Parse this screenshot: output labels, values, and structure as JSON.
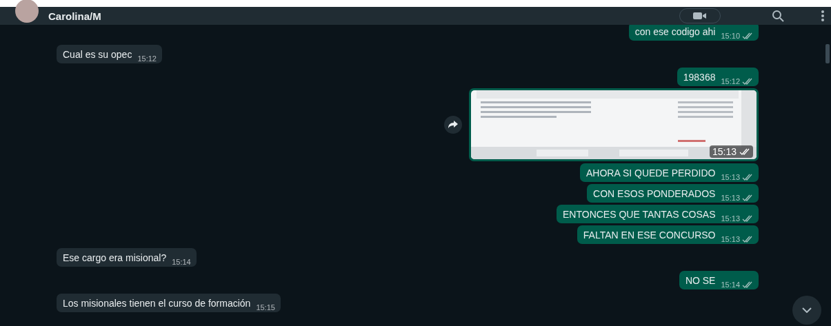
{
  "contact": {
    "name": "Carolina/M"
  },
  "messages": [
    {
      "kind": "text",
      "outgoing": true,
      "text": "con ese codigo ahi",
      "time": "15:10"
    },
    {
      "kind": "text",
      "outgoing": false,
      "text": "Cual es su opec",
      "time": "15:12"
    },
    {
      "kind": "text",
      "outgoing": true,
      "text": "198368",
      "time": "15:12"
    },
    {
      "outgoing": true,
      "time": "15:13"
    },
    {
      "kind": "text",
      "outgoing": true,
      "text": "AHORA SI QUEDE PERDIDO",
      "time": "15:13"
    },
    {
      "kind": "text",
      "outgoing": true,
      "text": "CON ESOS PONDERADOS",
      "time": "15:13"
    },
    {
      "kind": "text",
      "outgoing": true,
      "text": "ENTONCES QUE TANTAS COSAS",
      "time": "15:13"
    },
    {
      "kind": "text",
      "outgoing": true,
      "text": "FALTAN EN ESE CONCURSO",
      "time": "15:13"
    },
    {
      "kind": "text",
      "outgoing": false,
      "text": "Ese cargo era misional?",
      "time": "15:14"
    },
    {
      "kind": "text",
      "outgoing": true,
      "text": "NO SE",
      "time": "15:14"
    },
    {
      "kind": "text",
      "outgoing": false,
      "text": "Los misionales tienen el curso de formación",
      "time": "15:15"
    }
  ]
}
